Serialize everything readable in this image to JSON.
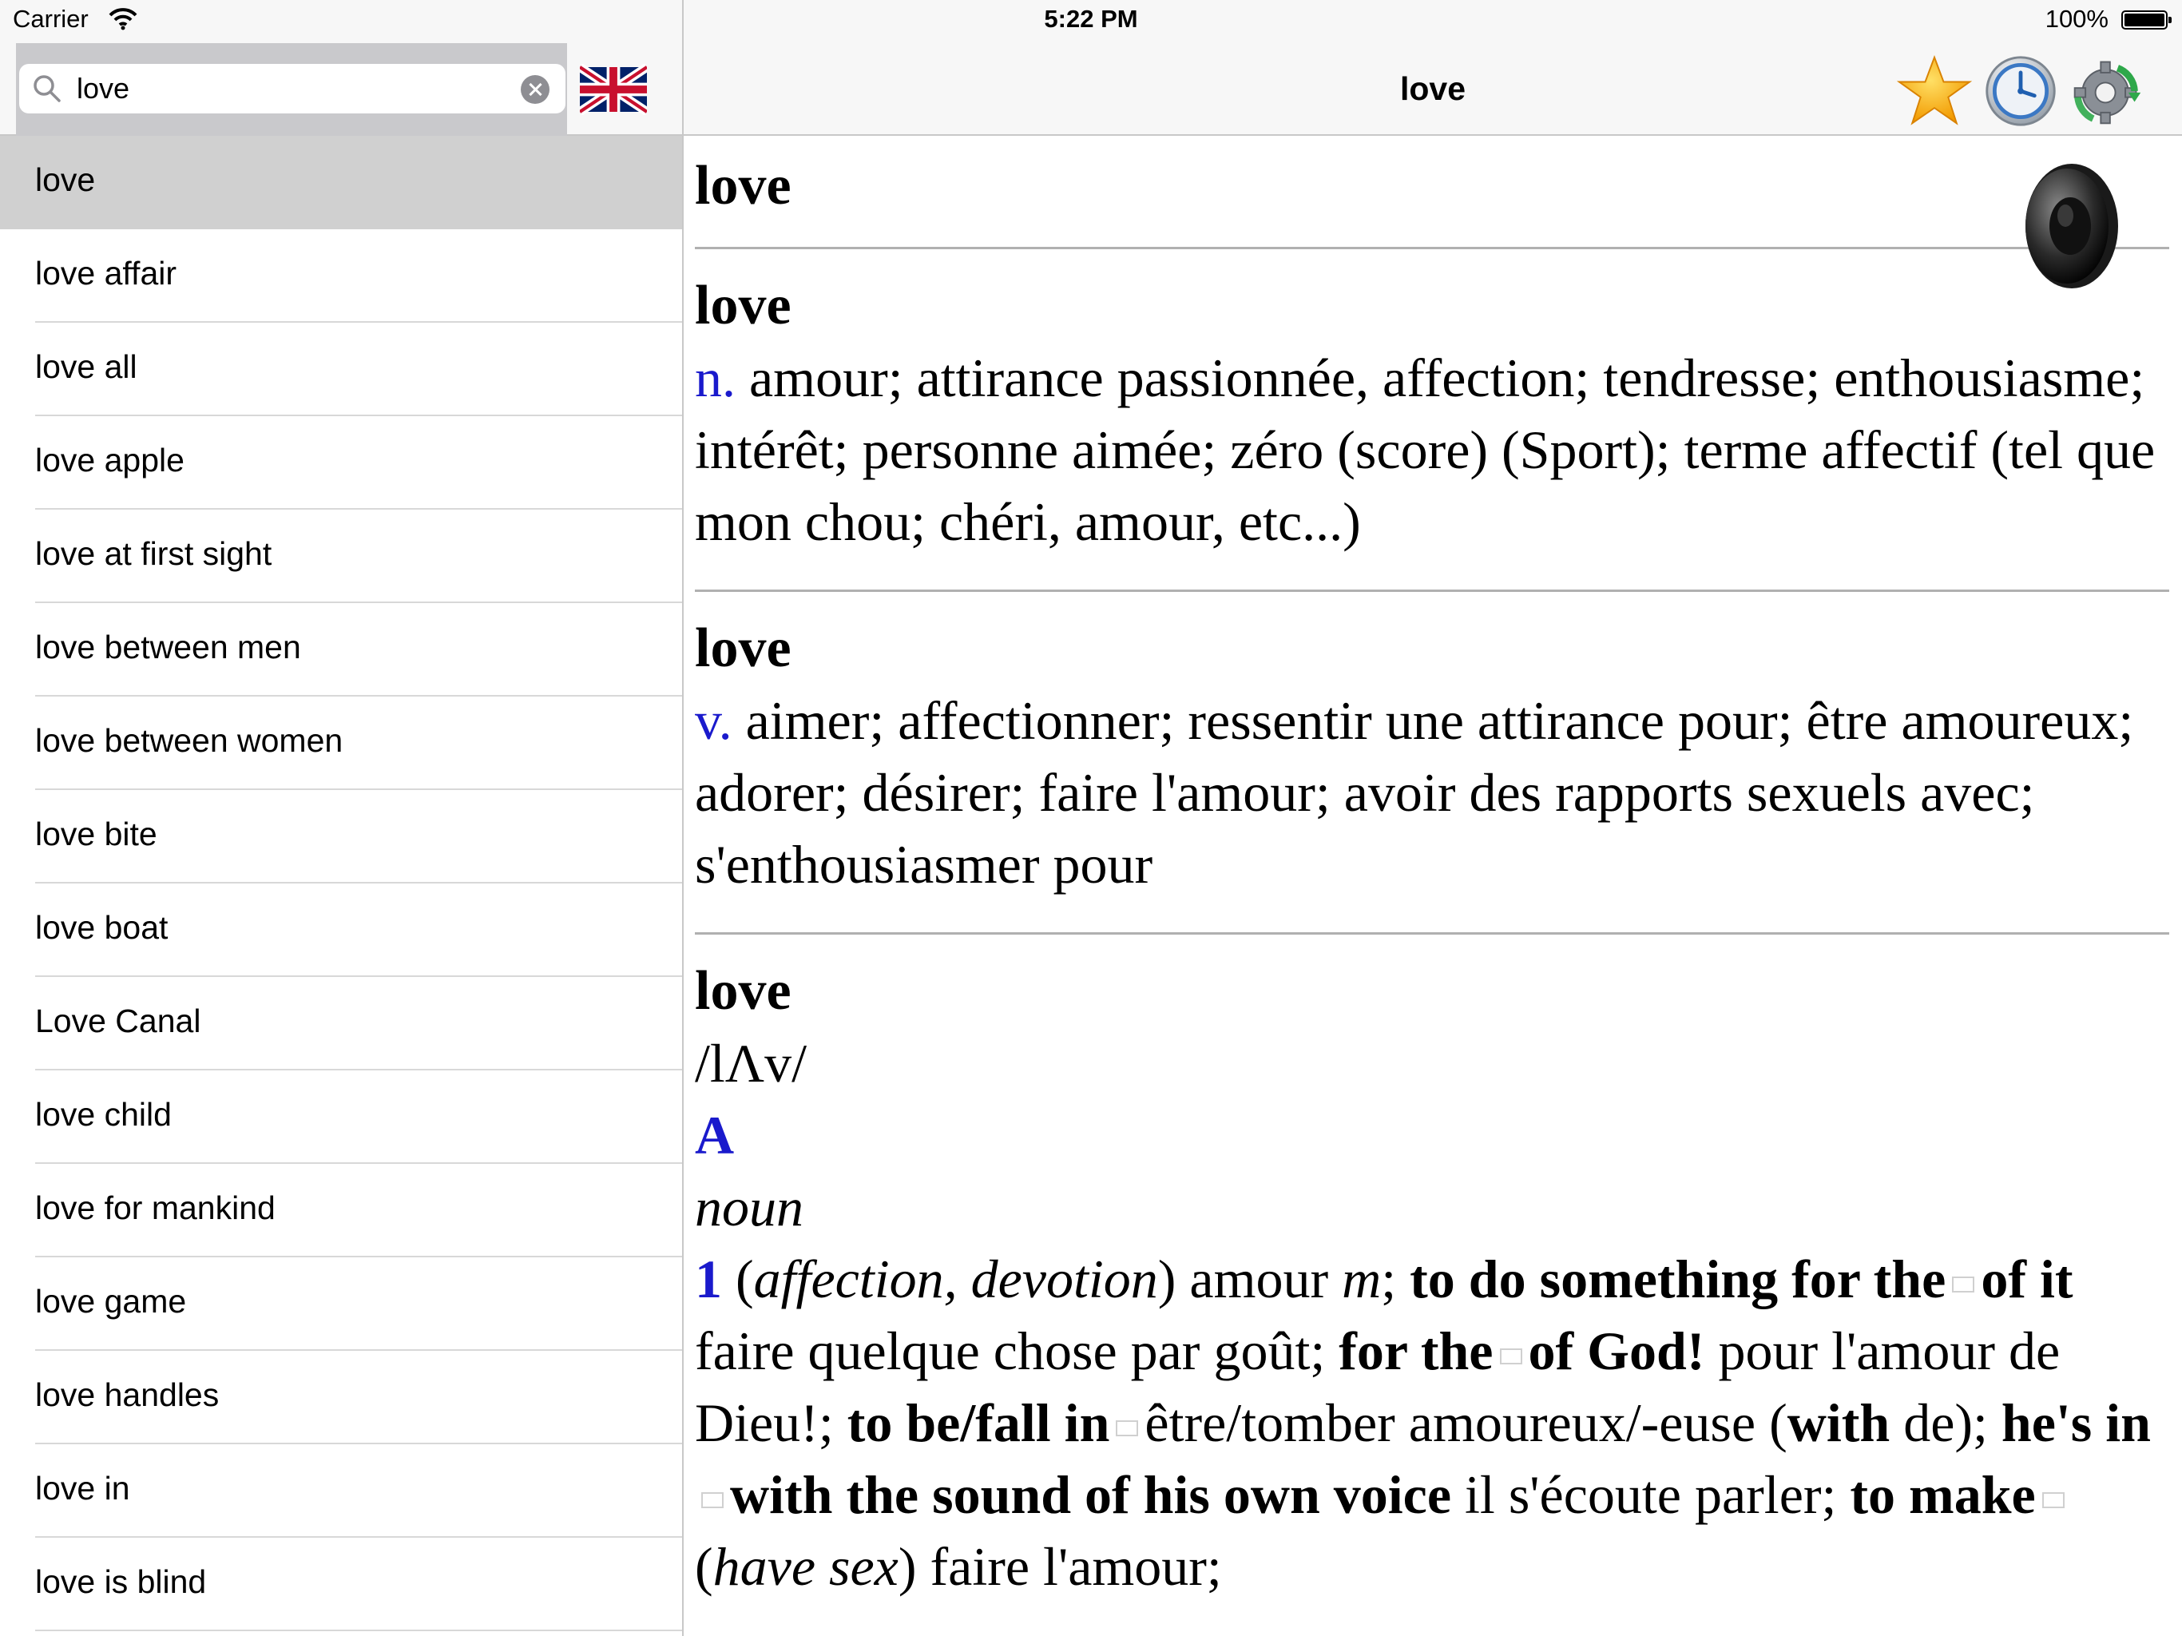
{
  "status_bar": {
    "carrier": "Carrier",
    "time": "5:22 PM",
    "battery": "100%"
  },
  "search": {
    "value": "love"
  },
  "word_list": [
    "love",
    "love affair",
    "love all",
    "love apple",
    "love at first sight",
    "love between men",
    "love between women",
    "love bite",
    "love boat",
    "Love Canal",
    "love child",
    "love for mankind",
    "love game",
    "love handles",
    "love in",
    "love is blind"
  ],
  "nav": {
    "title": "love"
  },
  "entry": {
    "headword": "love",
    "n": {
      "headword": "love",
      "pos": "n.",
      "definition": "amour; attirance passionnée, affection; tendresse; enthousiasme; intérêt; personne aimée; zéro (score) (Sport); terme affectif (tel que mon chou; chéri, amour, etc...)"
    },
    "v": {
      "headword": "love",
      "pos": "v.",
      "definition": "aimer; affectionner; ressentir une attirance pour; être amoureux; adorer; désirer; faire l'amour; avoir des rapports sexuels avec; s'enthousiasmer pour"
    },
    "full": {
      "headword": "love",
      "pronunciation": "/lΛv/",
      "part": "A",
      "pos": "noun",
      "sense_num": "1",
      "s_open": "(",
      "s_gloss": "affection, devotion",
      "s_close": ")",
      "s1": "amour",
      "s1_gender": "m",
      "s1_sep": ";",
      "p1": "to do something for the",
      "p1b": "of it",
      "t1": "faire quelque chose par goût;",
      "p2": "for the",
      "p2b": "of God!",
      "t2": "pour l'amour de Dieu!;",
      "p3": "to be/fall in",
      "t3a": "être/tomber amoureux/-euse (",
      "t3_with": "with",
      "t3b": "de);",
      "p4": "he's in",
      "p4b": "with the sound of his own voice",
      "t4": "il s'écoute parler;",
      "p5": "to make",
      "t5a": "(",
      "t5_gloss": "have sex",
      "t5b": ") faire l'amour;"
    }
  },
  "colors": {
    "accent_blue": "#1a1acc",
    "selected_row": "#d0d0d0",
    "bar_bg": "#f7f7f7"
  },
  "icons": [
    "wifi-icon",
    "battery-icon",
    "search-icon",
    "clear-icon",
    "uk-flag-icon",
    "star-icon",
    "clock-icon",
    "settings-refresh-icon",
    "speaker-icon"
  ]
}
